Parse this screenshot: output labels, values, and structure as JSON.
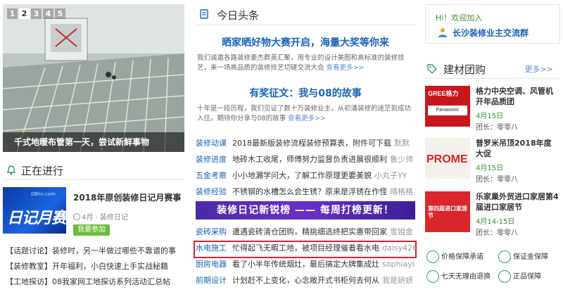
{
  "slider": {
    "pages": [
      "2",
      "3",
      "4",
      "5"
    ],
    "active_page": "2",
    "caption": "千式地暖布管第一天，尝试新鲜事物"
  },
  "ongoing": {
    "title": "正在进行",
    "diary": {
      "thumb_text": "日记月赛",
      "title": "2018年原创装修日记月赛事",
      "meta": "4月 · 装修日记",
      "button": "我要参加"
    },
    "links": [
      "【话题讨论】装修时，另一半做过哪些不靠谱的事",
      "【装修教室】开年福利，小白快速上手实战秘籍",
      "【工地探访】08我家网工地探访系列活动汇总帖"
    ]
  },
  "headlines": {
    "title": "今日头条",
    "feature1": {
      "title": "晒家晒好物大赛开启，海量大奖等你来",
      "desc": "我们诚邀各路装修豪杰群英汇聚，用专业的设计美图和高标准的装修技艺，来一场高品质的装修技艺切磋交流大会",
      "more": "查看更多>>"
    },
    "feature2": {
      "title": "有奖征文：我与08的故事",
      "desc": "十年是一段历程，我们见证了数十万装修业主，从初涌装修的迷茫到成功入住。期待你分享与08的故事",
      "more": "查看更多>>"
    },
    "news": [
      {
        "cat": "装修动课",
        "txt": "2018最新版装修流程装修预算表，附件可下载",
        "who": "默默"
      },
      {
        "cat": "装修进度",
        "txt": "地砖木工收尾，师傅努力监督负责进展很顺利",
        "who": "鲁少帅"
      },
      {
        "cat": "五金考察",
        "txt": "小小地漏学问大，了解工作原理更要美貌",
        "who": "小丸子YY"
      },
      {
        "cat": "装修经验",
        "txt": "不锈钢的水槽怎么会生锈？原来是浮锈在作怪",
        "who": "晴格格"
      }
    ],
    "banner": "装修日记新锐榜 —— 每周打榜更新！",
    "news2": [
      {
        "cat": "瓷砖采购",
        "txt": "遭遇瓷砖清仓团购，精挑细选终把实惠带回家",
        "who": "雪姐金"
      },
      {
        "cat": "水电施工",
        "txt": "忙得起飞无暇工地，被项目经理催着看水电",
        "who": "daisy426"
      },
      {
        "cat": "厨房电器",
        "txt": "看了小半年传统烟灶，最后搞定大牌集成灶",
        "who": "sophiayin"
      },
      {
        "cat": "前期设计",
        "txt": "计划赶不上变化，心念敞开式书柜何去何从",
        "who": "我是妍妍"
      }
    ]
  },
  "join": {
    "hi": "Hi！欢迎加入",
    "group": "长沙装修业主交流群"
  },
  "groupbuy": {
    "title": "建材团购",
    "more": "更多>>",
    "items": [
      {
        "thumb": "GREE格力",
        "name": "格力中央空调、风管机开年品质团",
        "date": "4月15日",
        "leader": "团长：零零八"
      },
      {
        "thumb": "PROME",
        "name": "普罗米吊顶2018年度大促",
        "date": "4月15日",
        "leader": "团长：零零八"
      },
      {
        "thumb": "第四届进口家居节",
        "name": "乐家巢外贸进口家居第4届进口家居节",
        "date": "4月14-15日",
        "leader": "团长：零零八"
      }
    ]
  },
  "guarantees": [
    "价格保障承诺",
    "保证金保障",
    "七天无理由退换",
    "正品保障"
  ],
  "colors": {
    "link_blue": "#1a63b8",
    "highlight_red": "#d9262c",
    "banner_purple": "#5a2bb8",
    "green": "#6dbb3f"
  }
}
